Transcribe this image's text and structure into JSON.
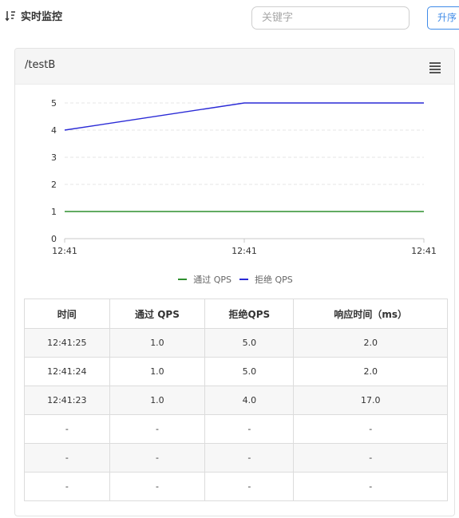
{
  "header": {
    "title": "实时监控",
    "search_placeholder": "关键字",
    "sort_label": "升序"
  },
  "card": {
    "title": "/testB"
  },
  "chart_data": {
    "type": "line",
    "x": [
      "12:41:23",
      "12:41:24",
      "12:41:25"
    ],
    "x_tick_labels": [
      "12:41",
      "12:41",
      "12:41"
    ],
    "y_ticks": [
      "0",
      "1",
      "2",
      "3",
      "4",
      "5"
    ],
    "ylim": [
      0,
      5
    ],
    "grid": true,
    "legend_position": "bottom",
    "series": [
      {
        "name": "通过 QPS",
        "color": "#2f8f2f",
        "values": [
          1,
          1,
          1
        ]
      },
      {
        "name": "拒绝 QPS",
        "color": "#2a2ad6",
        "values": [
          4,
          5,
          5
        ]
      }
    ]
  },
  "table": {
    "headers": [
      "时间",
      "通过 QPS",
      "拒绝QPS",
      "响应时间（ms）"
    ],
    "rows": [
      [
        "12:41:25",
        "1.0",
        "5.0",
        "2.0"
      ],
      [
        "12:41:24",
        "1.0",
        "5.0",
        "2.0"
      ],
      [
        "12:41:23",
        "1.0",
        "4.0",
        "17.0"
      ],
      [
        "-",
        "-",
        "-",
        "-"
      ],
      [
        "-",
        "-",
        "-",
        "-"
      ],
      [
        "-",
        "-",
        "-",
        "-"
      ]
    ]
  }
}
